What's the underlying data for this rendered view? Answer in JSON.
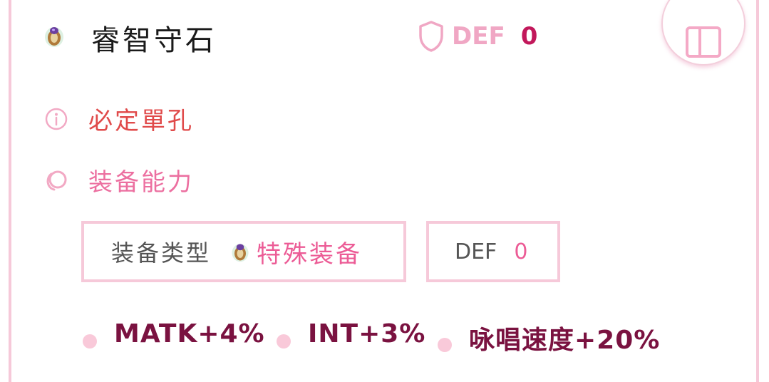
{
  "item": {
    "name": "睿智守石",
    "icon": "ring-icon",
    "def_label": "DEF",
    "def_value": "0"
  },
  "requirement": {
    "icon": "info-icon",
    "text": "必定單孔"
  },
  "ability": {
    "icon": "swirl-icon",
    "title": "装备能力"
  },
  "equip_type": {
    "label": "装备类型",
    "icon": "ring-icon",
    "value": "特殊装备"
  },
  "def_chip": {
    "label": "DEF",
    "value": "0"
  },
  "stats": [
    "MATK+4%",
    "INT+3%",
    "咏唱速度+20%"
  ],
  "colors": {
    "accent_pink": "#ec5c96",
    "border_pink": "#f6c9d9",
    "warning_red": "#e04a4a",
    "stat_text": "#7a1240"
  }
}
